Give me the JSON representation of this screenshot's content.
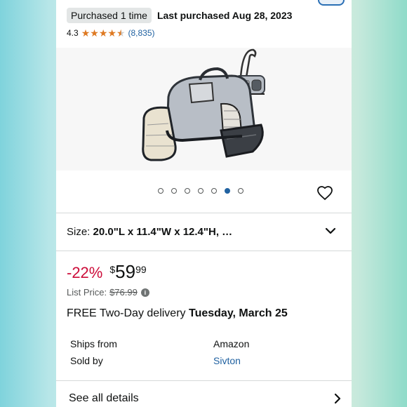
{
  "purchase": {
    "badge": "Purchased 1 time",
    "last": "Last purchased Aug 28, 2023"
  },
  "rating": {
    "value": "4.3",
    "stars": 4.3,
    "count": "(8,835)",
    "star_color": "#de7921"
  },
  "gallery": {
    "image_count": 7,
    "active_index": 5,
    "active_color": "#2162a1",
    "wishlist_icon": "heart-outline-icon"
  },
  "size": {
    "label": "Size: ",
    "value": "20.0\"L x 11.4\"W x 12.4\"H, …",
    "icon": "chevron-down-icon"
  },
  "price": {
    "discount": "-22%",
    "symbol": "$",
    "whole": "59",
    "fraction": "99",
    "discount_color": "#cc0c39",
    "list_label": "List Price:",
    "list_value": "$76.99",
    "info_icon": "i"
  },
  "delivery": {
    "prefix": "FREE Two-Day delivery ",
    "date": "Tuesday, March 25"
  },
  "details": [
    {
      "key": "Ships from",
      "value": "Amazon"
    },
    {
      "key": "Sold by",
      "value": "Sivton"
    }
  ],
  "see_all": {
    "label": "See all details",
    "icon": "chevron-right-icon"
  }
}
